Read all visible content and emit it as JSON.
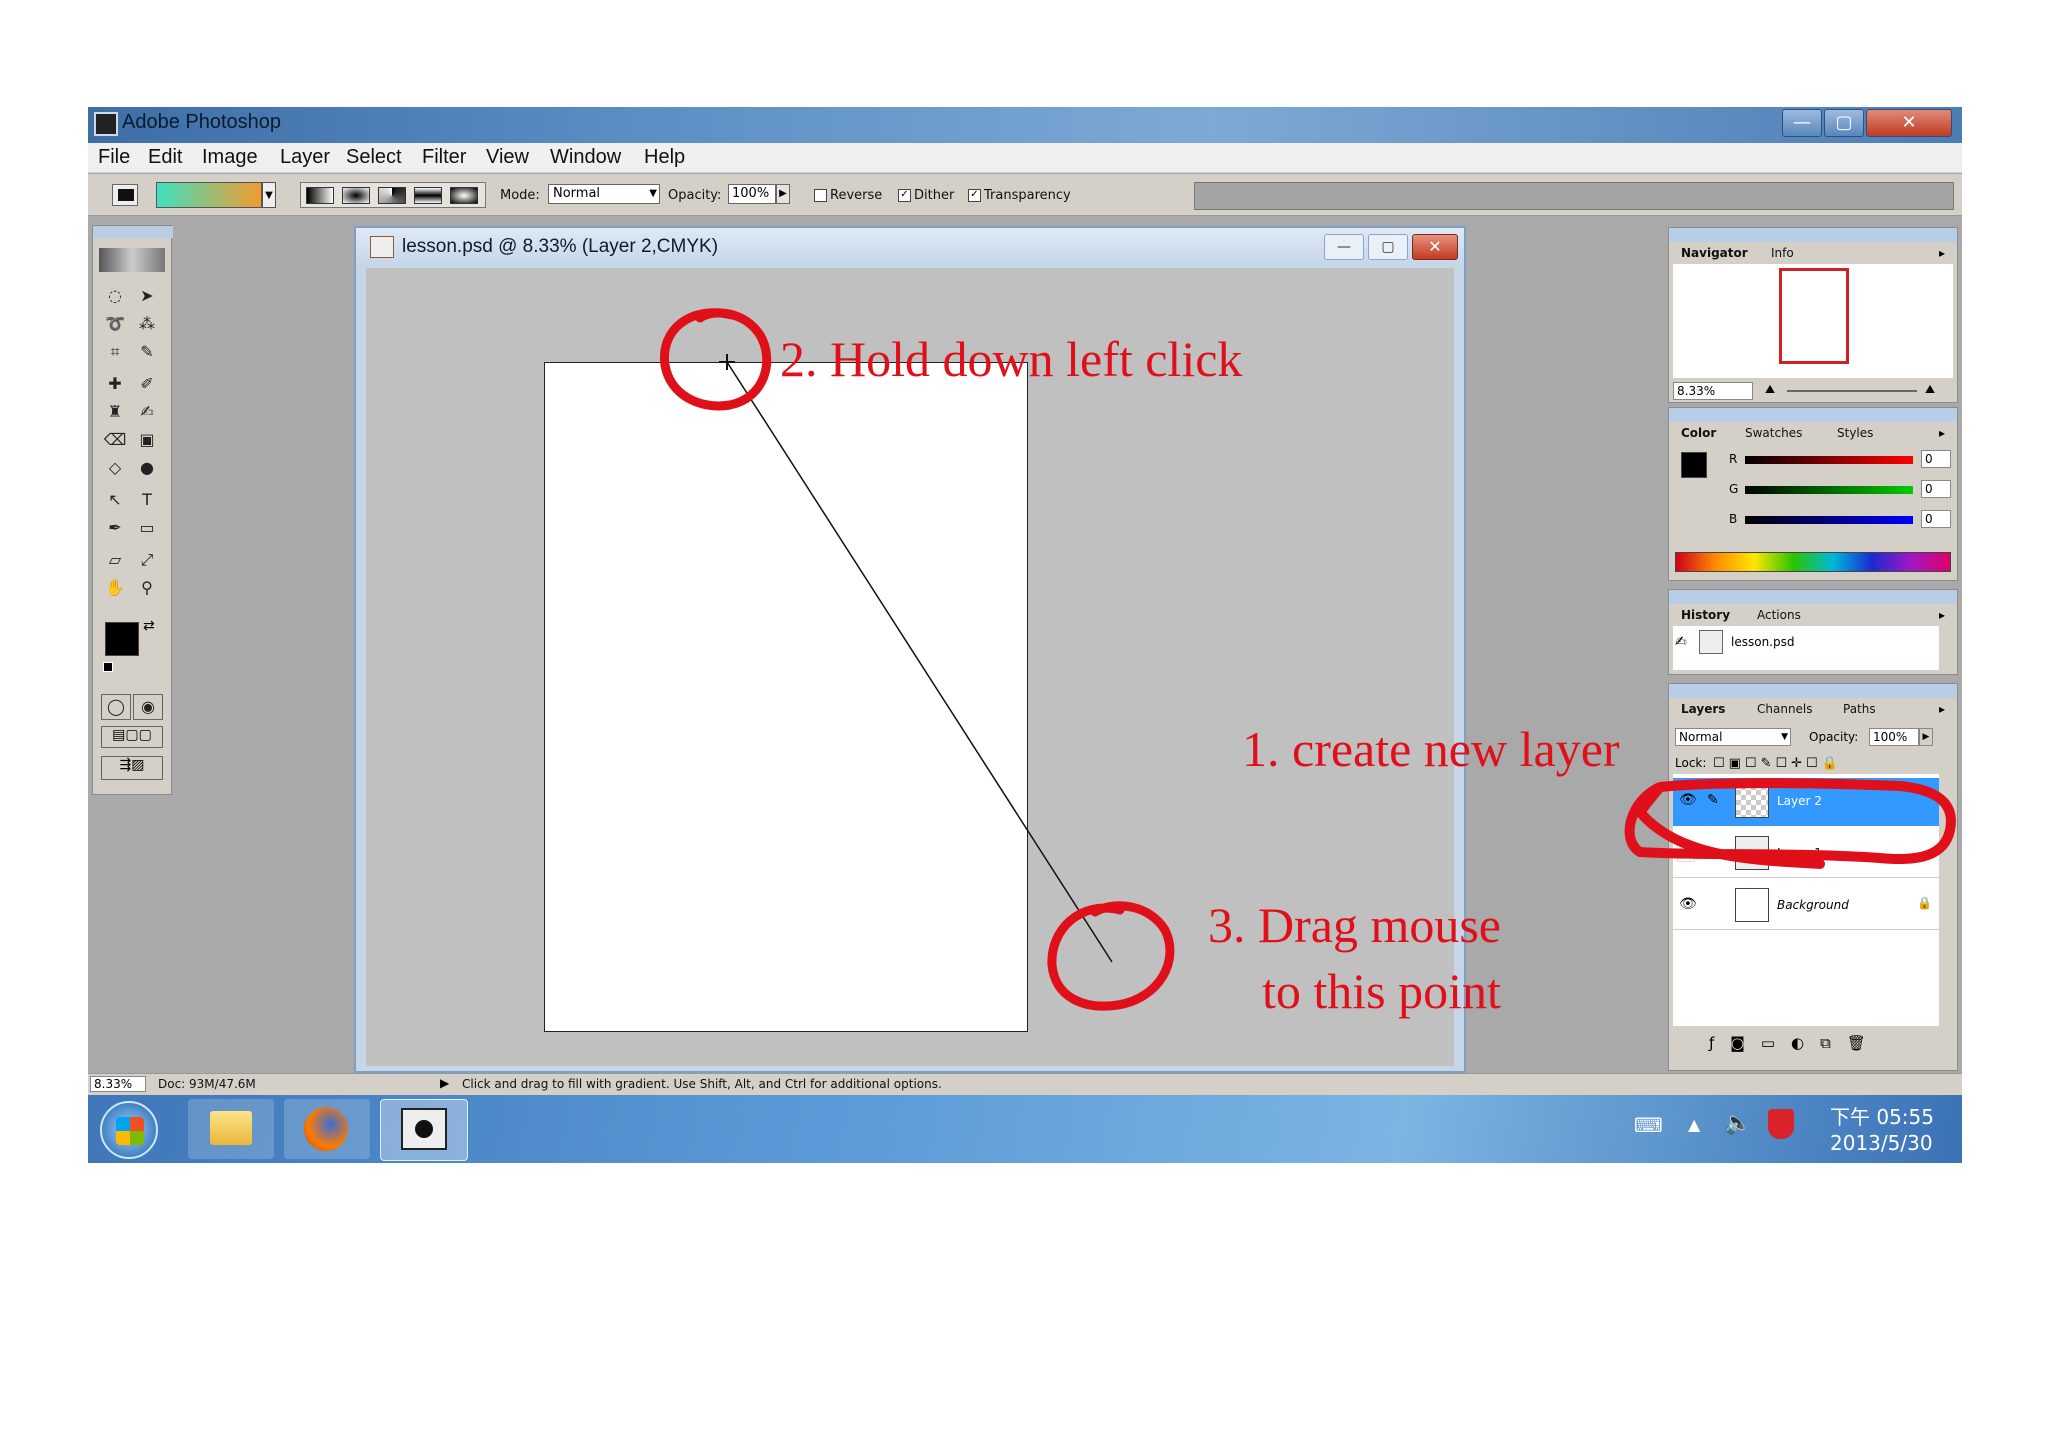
{
  "window": {
    "title": "Adobe Photoshop",
    "min": "—",
    "max": "▢",
    "close": "✕"
  },
  "menu": [
    "File",
    "Edit",
    "Image",
    "Layer",
    "Select",
    "Filter",
    "View",
    "Window",
    "Help"
  ],
  "options": {
    "mode_label": "Mode:",
    "mode_value": "Normal",
    "opacity_label": "Opacity:",
    "opacity_value": "100%",
    "reverse_label": "Reverse",
    "reverse_checked": false,
    "dither_label": "Dither",
    "dither_checked": true,
    "transparency_label": "Transparency",
    "transparency_checked": true
  },
  "document": {
    "title": "lesson.psd @ 8.33% (Layer 2,CMYK)",
    "min": "—",
    "max": "▢",
    "close": "✕"
  },
  "navigator": {
    "tabs": [
      "Navigator",
      "Info"
    ],
    "zoom": "8.33%"
  },
  "color_panel": {
    "tabs": [
      "Color",
      "Swatches",
      "Styles"
    ],
    "channels": [
      {
        "label": "R",
        "value": "0"
      },
      {
        "label": "G",
        "value": "0"
      },
      {
        "label": "B",
        "value": "0"
      }
    ]
  },
  "history": {
    "tabs": [
      "History",
      "Actions"
    ],
    "items": [
      "lesson.psd"
    ]
  },
  "layers": {
    "tabs": [
      "Layers",
      "Channels",
      "Paths"
    ],
    "blend": "Normal",
    "opacity_label": "Opacity:",
    "opacity_value": "100%",
    "lock_label": "Lock:",
    "items": [
      {
        "name": "Layer 2",
        "visible": true,
        "selected": true
      },
      {
        "name": "Layer 1",
        "visible": false,
        "selected": false
      },
      {
        "name": "Background",
        "visible": true,
        "selected": false
      }
    ]
  },
  "status": {
    "zoom": "8.33%",
    "doc": "Doc: 93M/47.6M",
    "hint": "Click and drag to fill with gradient.  Use Shift, Alt, and Ctrl for additional options."
  },
  "taskbar": {
    "time": "下午 05:55",
    "date": "2013/5/30"
  },
  "annotations": {
    "step1": "1. create new layer",
    "step2": "2. Hold down left click",
    "step3_line1": "3. Drag mouse",
    "step3_line2": "to this point"
  },
  "colors": {
    "annotation": "#e0101a",
    "layer_selected": "#3399ff",
    "foreground": "#000000",
    "background": "#ffffff"
  }
}
